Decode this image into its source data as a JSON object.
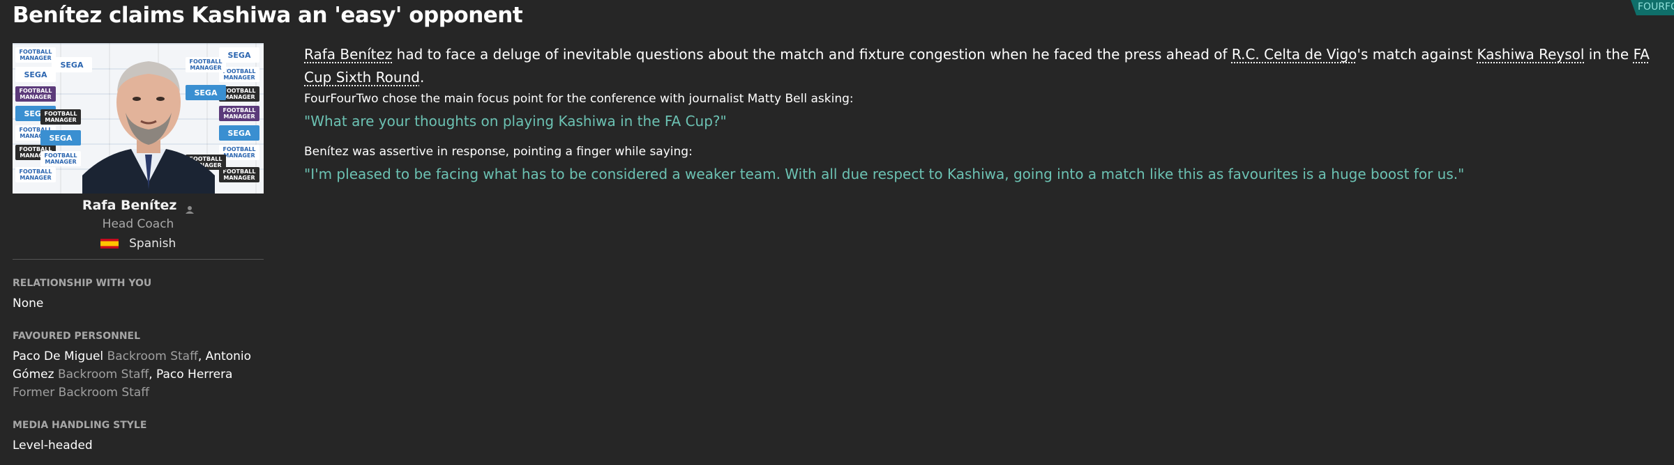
{
  "article": {
    "title": "Benítez claims Kashiwa an 'easy' opponent",
    "source_tag": "FOURFOURTWO"
  },
  "profile": {
    "name": "Rafa Benítez",
    "role": "Head Coach",
    "nationality": "Spanish",
    "photo_tiles": {
      "sega": "SEGA",
      "fm": "FOOTBALL MANAGER"
    }
  },
  "relationship": {
    "label": "RELATIONSHIP WITH YOU",
    "value": "None"
  },
  "favoured": {
    "label": "FAVOURED PERSONNEL",
    "people": [
      {
        "name": "Paco De Miguel",
        "role": "Backroom Staff"
      },
      {
        "name": "Antonio Gómez",
        "role": "Backroom Staff"
      },
      {
        "name": "Paco Herrera",
        "role": "Former Backroom Staff"
      }
    ],
    "separator": ", "
  },
  "media": {
    "label": "MEDIA HANDLING STYLE",
    "value": "Level-headed"
  },
  "body": {
    "lead_parts": [
      {
        "text": "Rafa Benítez",
        "link": true
      },
      {
        "text": " had to face a deluge of inevitable questions about the match and fixture congestion when he faced the press ahead of ",
        "link": false
      },
      {
        "text": "R.C. Celta de Vigo",
        "link": true
      },
      {
        "text": "'s match against ",
        "link": false
      },
      {
        "text": "Kashiwa Reysol",
        "link": true
      },
      {
        "text": " in the ",
        "link": false
      },
      {
        "text": "FA Cup Sixth Round",
        "link": true
      },
      {
        "text": ".",
        "link": false
      }
    ],
    "intro1": "FourFourTwo chose the main focus point for the conference with journalist Matty Bell asking:",
    "question": "\"What are your thoughts on playing Kashiwa in the FA Cup?\"",
    "intro2": "Benítez was assertive in response, pointing a finger while saying:",
    "answer": "\"I'm pleased to be facing what has to be considered a weaker team. With all due respect to Kashiwa, going into a match like this as favourites is a huge boost for us.\""
  },
  "colors": {
    "background": "#262626",
    "quote": "#6cc2b3",
    "tag": "#0f6f6a"
  }
}
